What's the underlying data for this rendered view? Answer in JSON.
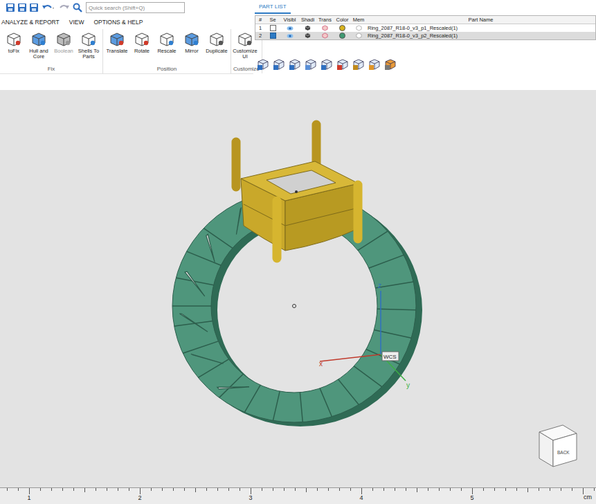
{
  "quickSearch": {
    "placeholder": "Quick search (Shift+Q)"
  },
  "panelTabs": [
    {
      "label": "PART LIST",
      "selected": true
    }
  ],
  "menus": [
    "ANALYZE & REPORT",
    "VIEW",
    "OPTIONS & HELP"
  ],
  "ribbonGroups": [
    {
      "label": "Fix",
      "buttons": [
        {
          "label": "toFix",
          "disabled": false
        },
        {
          "label": "Hull and Core",
          "disabled": false
        },
        {
          "label": "Boolean",
          "disabled": true
        },
        {
          "label": "Shells To Parts",
          "disabled": false
        }
      ]
    },
    {
      "label": "Position",
      "buttons": [
        {
          "label": "Translate",
          "disabled": false
        },
        {
          "label": "Rotate",
          "disabled": false
        },
        {
          "label": "Rescale",
          "disabled": false
        },
        {
          "label": "Mirror",
          "disabled": false
        },
        {
          "label": "Duplicate",
          "disabled": false
        }
      ]
    },
    {
      "label": "Customize",
      "buttons": [
        {
          "label": "Customize UI",
          "disabled": false
        }
      ]
    }
  ],
  "partList": {
    "columns": [
      "#",
      "Se",
      "Visibl",
      "Shadi",
      "Trans",
      "Color",
      "Mem",
      "Part Name"
    ],
    "rows": [
      {
        "index": "1",
        "checked": false,
        "selected": false,
        "color": "#d8b31c",
        "name": "Ring_2087_R18-0_v3_p1_Rescaled(1)"
      },
      {
        "index": "2",
        "checked": true,
        "selected": true,
        "color": "#3f9a72",
        "name": "Ring_2087_R18-0_v3_p2_Rescaled(1)"
      }
    ]
  },
  "viewport": {
    "parts": [
      {
        "name": "head",
        "color": "#c9a82a"
      },
      {
        "name": "shank",
        "color": "#4f967c"
      }
    ],
    "axes": [
      "x",
      "y",
      "z"
    ],
    "wcsLabel": "WCS",
    "viewCube": [
      "BACK"
    ]
  },
  "ruler": {
    "ticks": [
      "1",
      "2",
      "3",
      "4",
      "5"
    ],
    "unit": "cm"
  }
}
